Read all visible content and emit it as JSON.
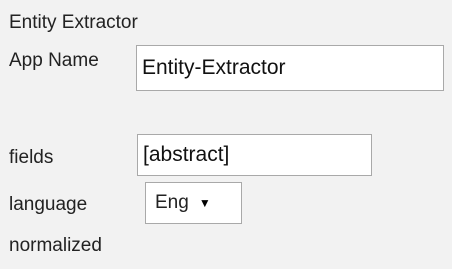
{
  "title": "Entity Extractor",
  "fields": {
    "app_name": {
      "label": "App Name",
      "value": "Entity-Extractor"
    },
    "fields": {
      "label": "fields",
      "value": "[abstract]"
    },
    "language": {
      "label": "language",
      "selected": "Eng",
      "caret_icon": "triangle-down-icon"
    },
    "normalized": {
      "label": "normalized"
    }
  }
}
